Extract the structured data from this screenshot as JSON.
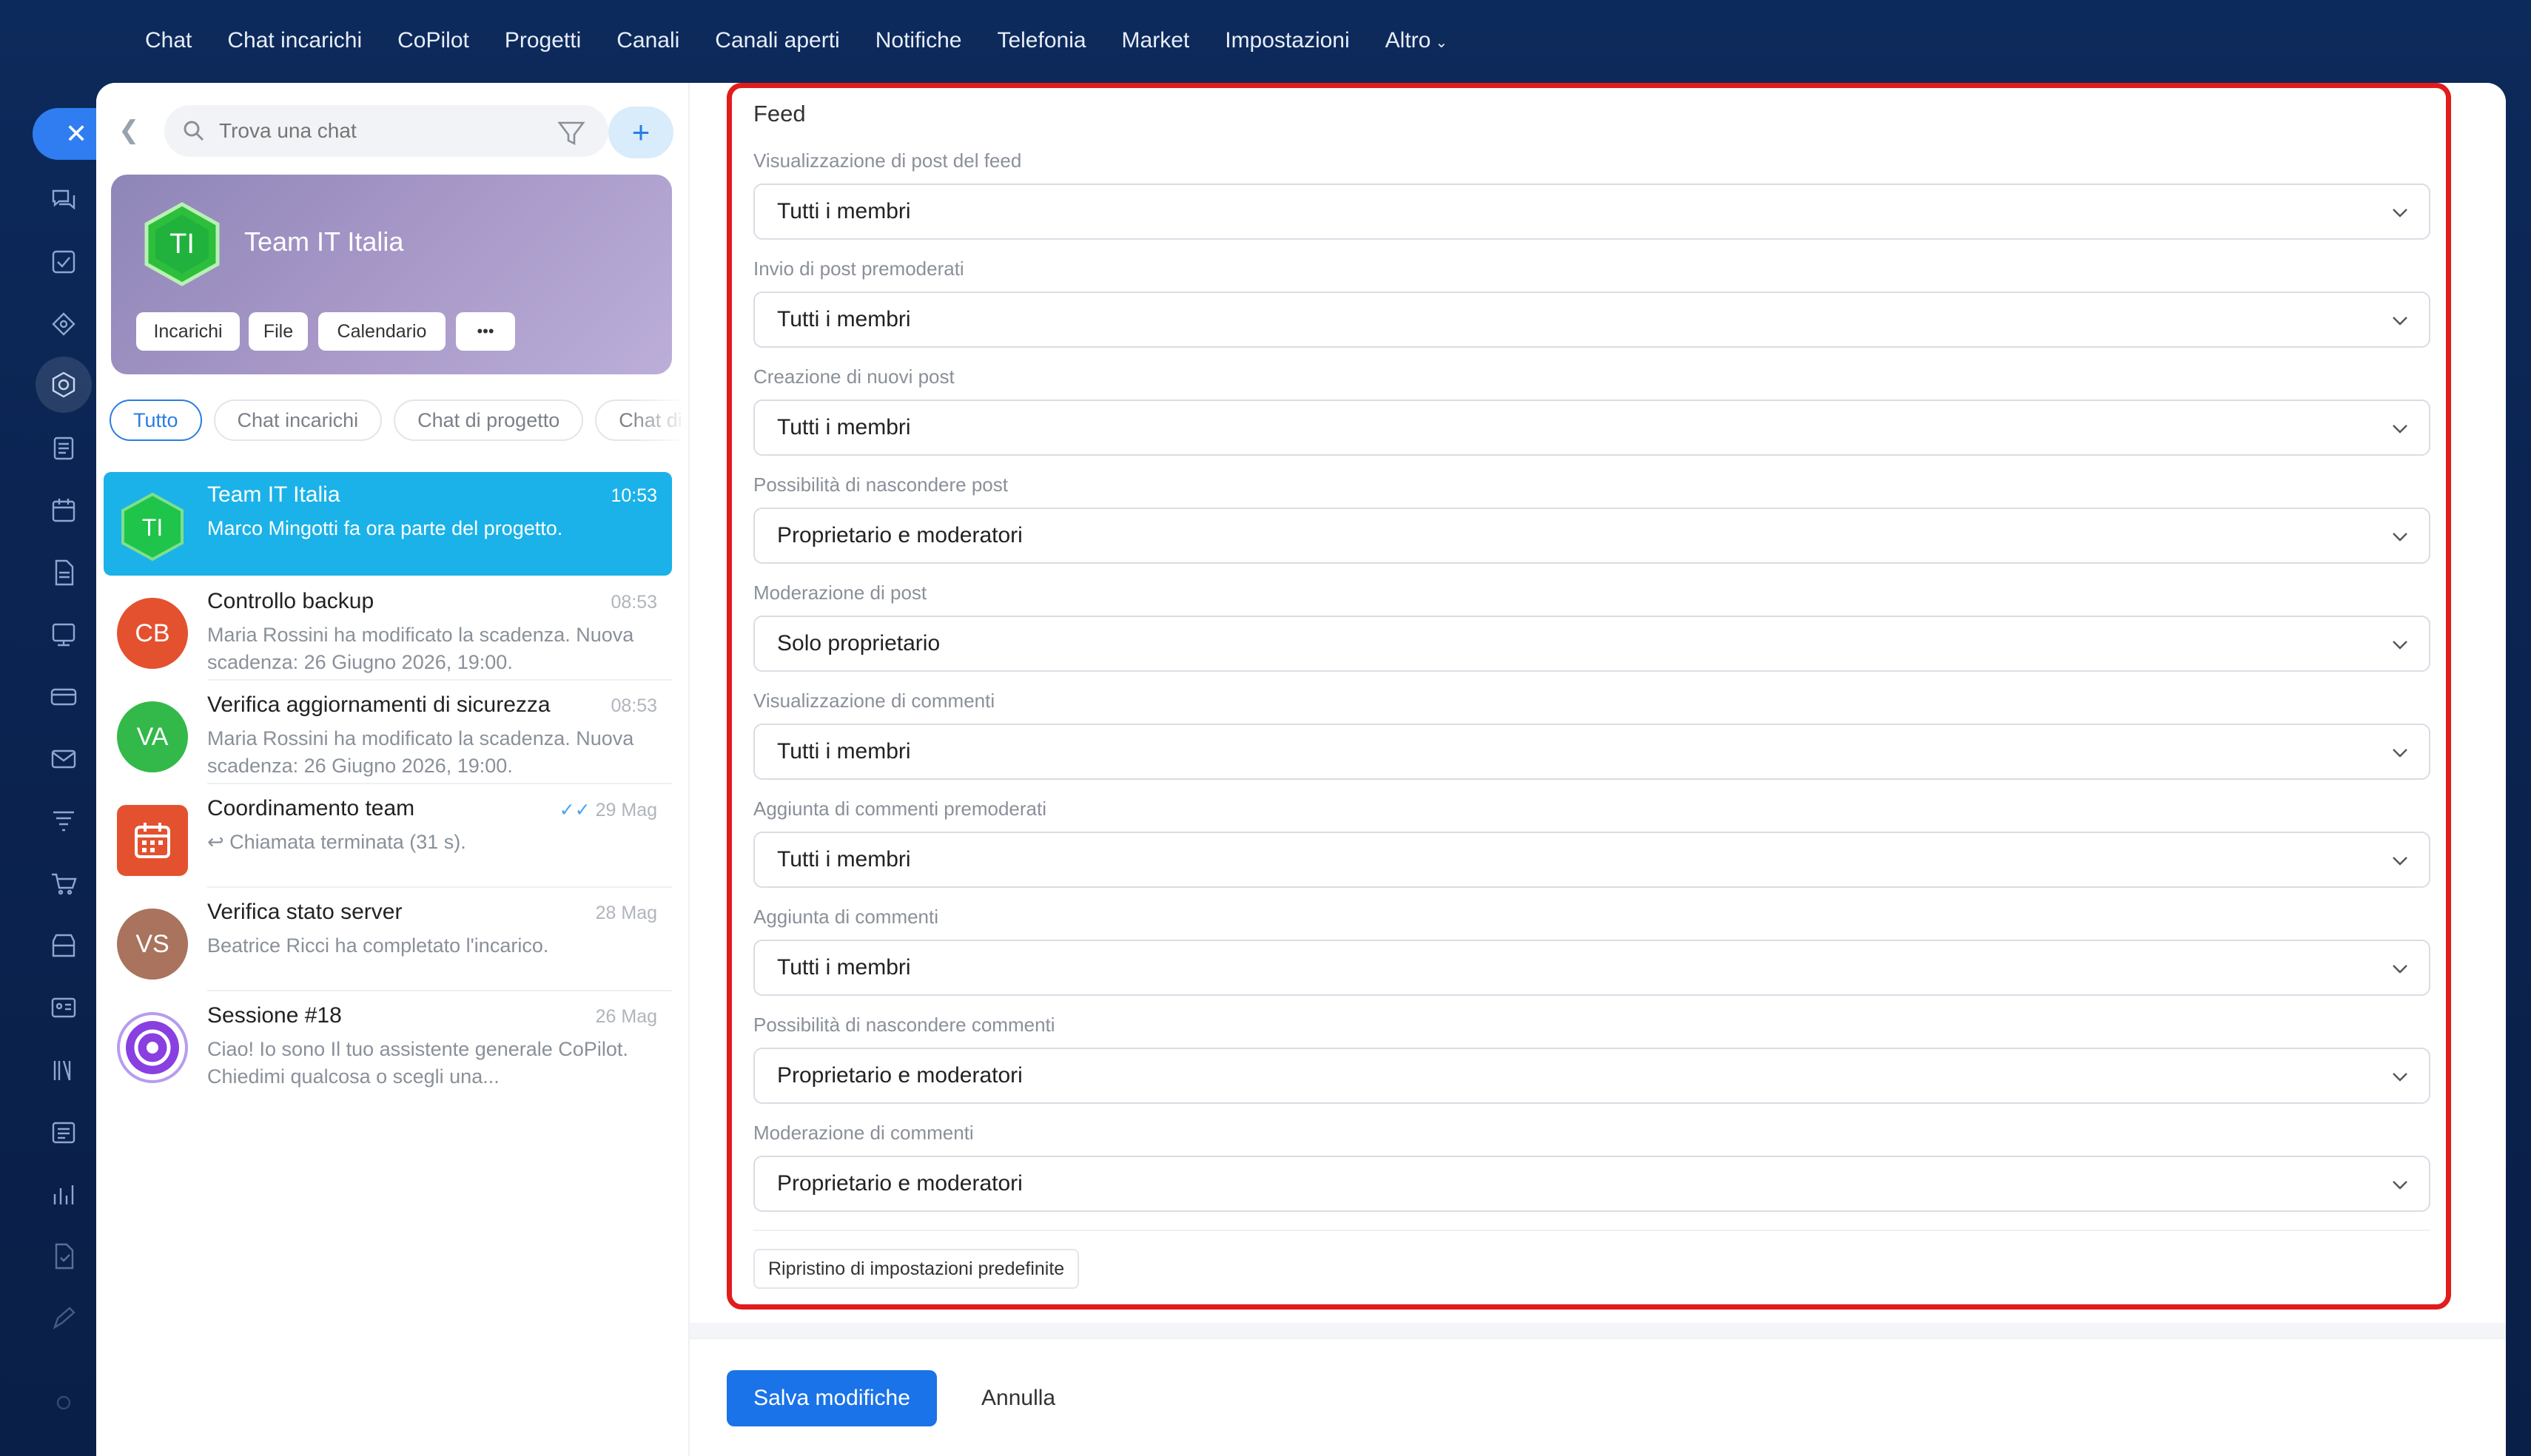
{
  "topnav": {
    "items": [
      "Chat",
      "Chat incarichi",
      "CoPilot",
      "Progetti",
      "Canali",
      "Canali aperti",
      "Notifiche",
      "Telefonia",
      "Market",
      "Impostazioni"
    ],
    "more": "Altro"
  },
  "sidebar": {
    "search_placeholder": "Trova una chat",
    "team": {
      "initials": "TI",
      "name": "Team IT Italia",
      "chips": [
        "Incarichi",
        "File",
        "Calendario",
        "•••"
      ]
    },
    "filters": [
      "Tutto",
      "Chat incarichi",
      "Chat di progetto",
      "Chat di"
    ],
    "chats": [
      {
        "initials": "TI",
        "title": "Team IT Italia",
        "time": "10:53",
        "msg": "Marco Mingotti fa ora parte del progetto.",
        "color": "#21c04a"
      },
      {
        "initials": "CB",
        "title": "Controllo backup",
        "time": "08:53",
        "msg": "Maria Rossini ha modificato la scadenza. Nuova scadenza: 26 Giugno 2026, 19:00.",
        "color": "#e4512f"
      },
      {
        "initials": "VA",
        "title": "Verifica aggiornamenti di sicurezza",
        "time": "08:53",
        "msg": "Maria Rossini ha modificato la scadenza. Nuova scadenza: 26 Giugno 2026, 19:00.",
        "color": "#33b94a"
      },
      {
        "initials": "",
        "title": "Coordinamento team",
        "time": "29 Mag",
        "msg": "Chiamata terminata (31 s).",
        "color": "#e4512f"
      },
      {
        "initials": "VS",
        "title": "Verifica stato server",
        "time": "28 Mag",
        "msg": "Beatrice Ricci ha completato l'incarico.",
        "color": "#a9735d"
      },
      {
        "initials": "",
        "title": "Sessione #18",
        "time": "26 Mag",
        "msg": "Ciao! Io sono Il tuo assistente generale CoPilot. Chiedimi qualcosa o scegli una...",
        "color": "#8a3fe0"
      }
    ]
  },
  "settings": {
    "section_title": "Feed",
    "fields": [
      {
        "label": "Visualizzazione di post del feed",
        "value": "Tutti i membri"
      },
      {
        "label": "Invio di post premoderati",
        "value": "Tutti i membri"
      },
      {
        "label": "Creazione di nuovi post",
        "value": "Tutti i membri"
      },
      {
        "label": "Possibilità di nascondere post",
        "value": "Proprietario e moderatori"
      },
      {
        "label": "Moderazione di post",
        "value": "Solo proprietario"
      },
      {
        "label": "Visualizzazione di commenti",
        "value": "Tutti i membri"
      },
      {
        "label": "Aggiunta di commenti premoderati",
        "value": "Tutti i membri"
      },
      {
        "label": "Aggiunta di commenti",
        "value": "Tutti i membri"
      },
      {
        "label": "Possibilità di nascondere commenti",
        "value": "Proprietario e moderatori"
      },
      {
        "label": "Moderazione di commenti",
        "value": "Proprietario e moderatori"
      }
    ],
    "reset_label": "Ripristino di impostazioni predefinite",
    "save_label": "Salva modifiche",
    "cancel_label": "Annulla"
  },
  "colors": {
    "accent": "#1a73e8",
    "highlight_border": "#e21b1b",
    "active_chat": "#1ab2e8"
  }
}
